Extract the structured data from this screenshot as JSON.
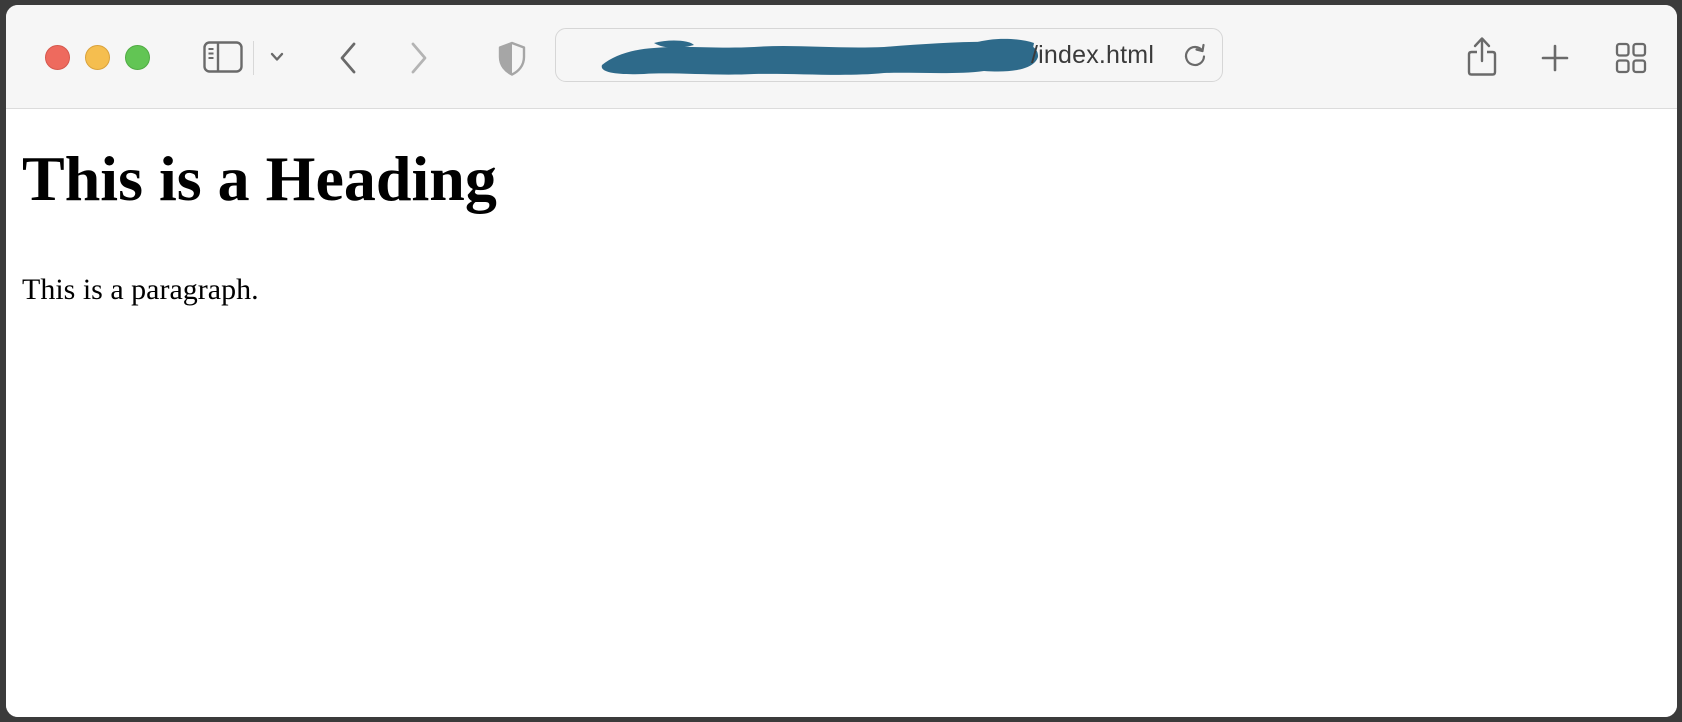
{
  "browser": {
    "address_bar": {
      "url_visible_suffix": "/index.html",
      "url_prefix_redacted": true
    },
    "colors": {
      "close": "#ee6a5e",
      "minimize": "#f5be4f",
      "maximize": "#62c554",
      "redaction": "#2e6a8a"
    },
    "icons": {
      "sidebar": "sidebar-icon",
      "sidebar_menu": "chevron-down-icon",
      "back": "chevron-left-icon",
      "forward": "chevron-right-icon",
      "privacy": "shield-icon",
      "reload": "reload-icon",
      "share": "share-icon",
      "new_tab": "plus-icon",
      "tab_overview": "grid-icon"
    }
  },
  "page": {
    "heading": "This is a Heading",
    "paragraph": "This is a paragraph."
  }
}
